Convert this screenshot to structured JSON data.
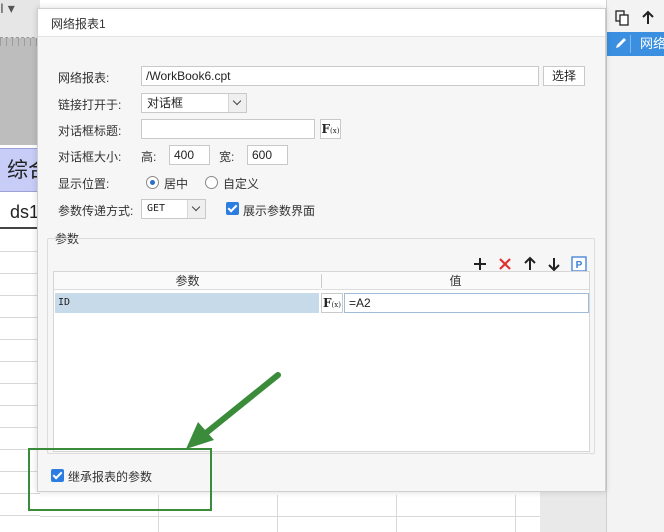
{
  "background": {
    "corner_text": "I ▾",
    "cell_title": "综合",
    "cell_ds": "ds1"
  },
  "side_panel": {
    "item_label": "网络"
  },
  "dialog": {
    "title": "网络报表1",
    "report_label": "网络报表:",
    "report_value": "/WorkBook6.cpt",
    "choose_button": "选择",
    "open_in_label": "链接打开于:",
    "open_in_value": "对话框",
    "dialog_title_label": "对话框标题:",
    "dialog_title_value": "",
    "dialog_size_label": "对话框大小:",
    "height_label": "高:",
    "height_value": "400",
    "width_label": "宽:",
    "width_value": "600",
    "position_label": "显示位置:",
    "position_center": "居中",
    "position_custom": "自定义",
    "param_method_label": "参数传递方式:",
    "param_method_value": "GET",
    "show_param_ui_label": "展示参数界面",
    "param_group_label": "参数",
    "table": {
      "col_param": "参数",
      "col_value": "值",
      "rows": [
        {
          "name": "ID",
          "value": "=A2"
        }
      ]
    },
    "inherit_params_label": "继承报表的参数"
  },
  "colors": {
    "accent": "#2b7de1",
    "side_selected": "#3a8fe0",
    "annotation": "#3a8b3a",
    "delete_icon": "#e03030"
  },
  "icons": [
    "copy-icon",
    "arrow-up-icon",
    "edit-icon",
    "add-icon",
    "delete-icon",
    "move-up-icon",
    "move-down-icon",
    "parameter-icon",
    "formula-icon"
  ]
}
